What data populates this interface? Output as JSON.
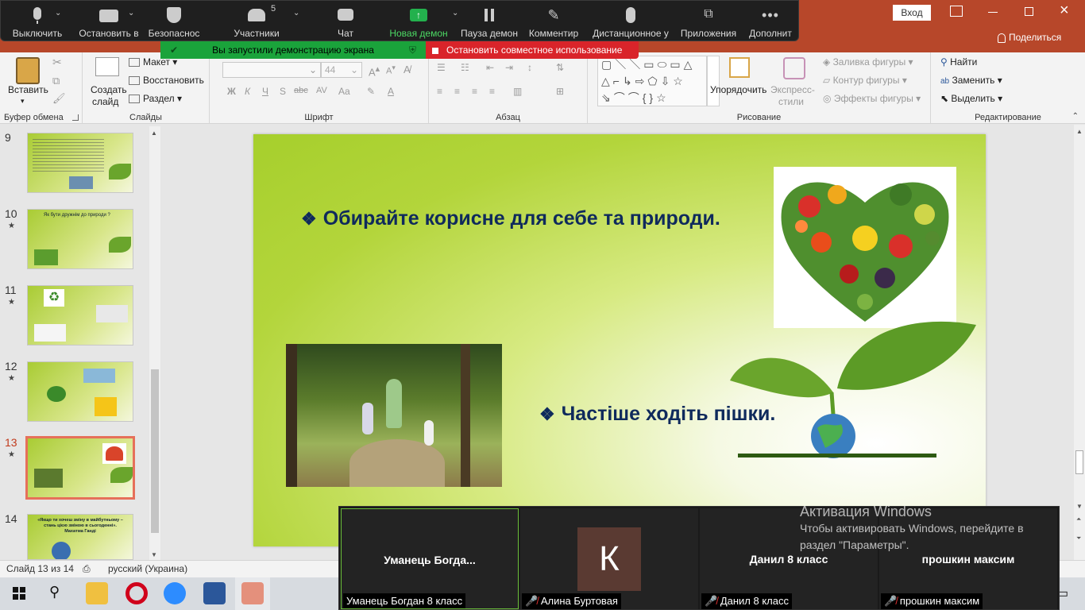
{
  "zoom_toolbar": {
    "mute": "Выключить",
    "video": "Остановить в",
    "security": "Безопаснос",
    "participants": "Участники",
    "participants_count": "5",
    "chat": "Чат",
    "new_share": "Новая демон",
    "pause_share": "Пауза демон",
    "annotate": "Комментир",
    "remote": "Дистанционное у",
    "apps": "Приложения",
    "more": "Дополнит"
  },
  "share_banner": {
    "sharing_text": "Вы запустили демонстрацию экрана",
    "stop_text": "Остановить совместное использование"
  },
  "window": {
    "login": "Вход",
    "share_button": "Поделиться"
  },
  "ribbon": {
    "clipboard": {
      "paste": "Вставить",
      "label": "Буфер обмена"
    },
    "slides": {
      "new_slide_line1": "Создать",
      "new_slide_line2": "слайд",
      "layout": "Макет",
      "reset": "Восстановить",
      "section": "Раздел",
      "label": "Слайды"
    },
    "font": {
      "size": "44",
      "bold": "Ж",
      "italic": "К",
      "underline": "Ч",
      "strike": "S",
      "shadow": "abc",
      "spacing": "AV",
      "case": "Aa",
      "color": "A",
      "label": "Шрифт"
    },
    "paragraph": {
      "label": "Абзац"
    },
    "drawing": {
      "arrange": "Упорядочить",
      "quick_styles_line1": "Экспресс-",
      "quick_styles_line2": "стили",
      "fill": "Заливка фигуры",
      "outline": "Контур фигуры",
      "effects": "Эффекты фигуры",
      "label": "Рисование"
    },
    "editing": {
      "find": "Найти",
      "replace": "Заменить",
      "select": "Выделить",
      "label": "Редактирование"
    }
  },
  "thumbnails": [
    {
      "num": "9",
      "star": ""
    },
    {
      "num": "10",
      "star": "★"
    },
    {
      "num": "11",
      "star": "★"
    },
    {
      "num": "12",
      "star": "★"
    },
    {
      "num": "13",
      "star": "★"
    },
    {
      "num": "14",
      "star": ""
    }
  ],
  "thumb_texts": {
    "t10_title": "Як бути дружнім до природи ?",
    "t14_title": "«Якщо ти хочеш зміну в майбутньому – стань цією зміною в сьогоденні». Махатма Ганді"
  },
  "slide": {
    "bullet1": "Обирайте корисне для себе та природи.",
    "bullet2": "Частіше ходіть пішки."
  },
  "status": {
    "slide_info": "Слайд 13 из 14",
    "language": "русский (Украина)"
  },
  "gallery": {
    "tiles": [
      {
        "name": "Уманець  Богда...",
        "label": "Уманець Богдан 8 класс"
      },
      {
        "name": "К",
        "label": "Алина Буртовая"
      },
      {
        "name": "Данил 8 класс",
        "label": "Данил 8 класс"
      },
      {
        "name": "прошкин максим",
        "label": "прошкин максим"
      }
    ]
  },
  "activation": {
    "title": "Активация Windows",
    "line1": "Чтобы активировать Windows, перейдите в",
    "line2": "раздел \"Параметры\"."
  },
  "colors": {
    "powerpoint_red": "#b7472a",
    "zoom_green": "#1aa33b",
    "stop_red": "#d9242a",
    "slide_text": "#0f2a5c",
    "avatar_brown": "#5a3a32"
  }
}
